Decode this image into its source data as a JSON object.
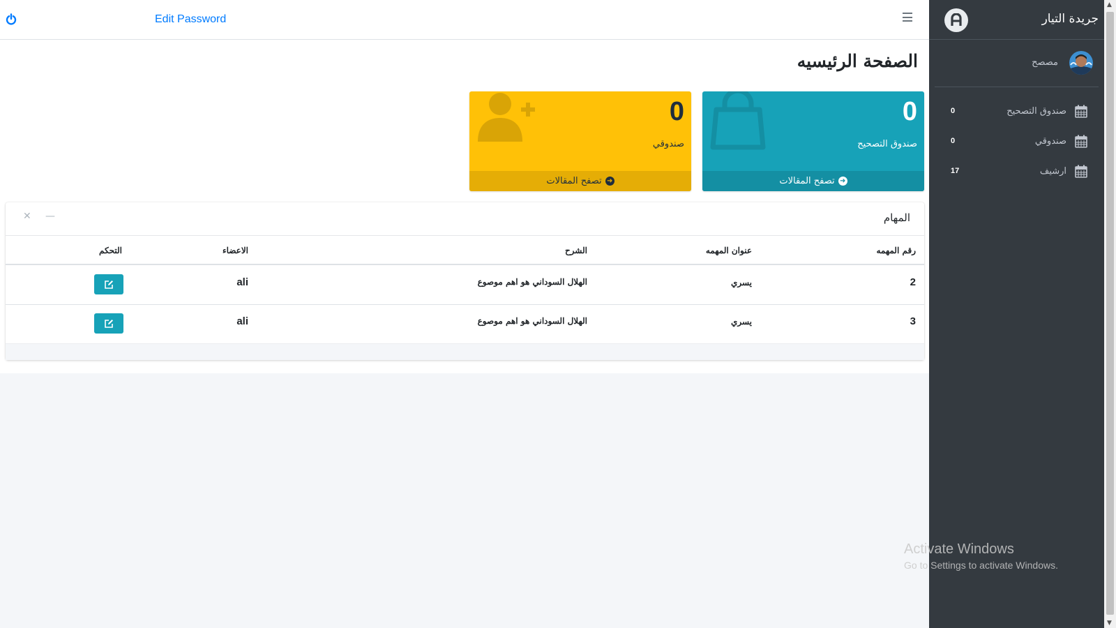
{
  "topbar": {
    "edit_password": "Edit Password"
  },
  "main": {
    "page_title": "الصفحة الرئيسيه",
    "boxes": [
      {
        "value": "0",
        "label": "صندوق التصحيح",
        "footer": "تصفح المقالات",
        "color": "#17a2b8",
        "icon": "shopping-bag-icon"
      },
      {
        "value": "0",
        "label": "صندوقي",
        "footer": "تصفح المقالات",
        "color": "#ffc107",
        "icon": "user-plus-icon"
      }
    ]
  },
  "tasks": {
    "title": "المهام",
    "headers": {
      "number": "رقم المهمه",
      "title": "عنوان المهمه",
      "description": "الشرح",
      "members": "الاعضاء",
      "control": "التحكم"
    },
    "rows": [
      {
        "number": "2",
        "title": "يسري",
        "description": "الهلال السوداني هو اهم موصوع",
        "members": "ali"
      },
      {
        "number": "3",
        "title": "يسري",
        "description": "الهلال السوداني هو اهم موصوع",
        "members": "ali"
      }
    ]
  },
  "sidebar": {
    "brand": "جريدة التيار",
    "user_name": "مصصح",
    "items": [
      {
        "label": "صندوق التصحيح",
        "count": "0",
        "icon": "calendar-icon"
      },
      {
        "label": "صندوقي",
        "count": "0",
        "icon": "calendar-icon"
      },
      {
        "label": "ارشيف",
        "count": "17",
        "icon": "calendar-icon"
      }
    ]
  },
  "watermark": {
    "title": "Activate Windows",
    "subtitle": "Go to Settings to activate Windows."
  },
  "colors": {
    "accent_teal": "#17a2b8",
    "accent_yellow": "#ffc107",
    "sidebar_bg": "#343a40",
    "link_blue": "#007bff"
  }
}
